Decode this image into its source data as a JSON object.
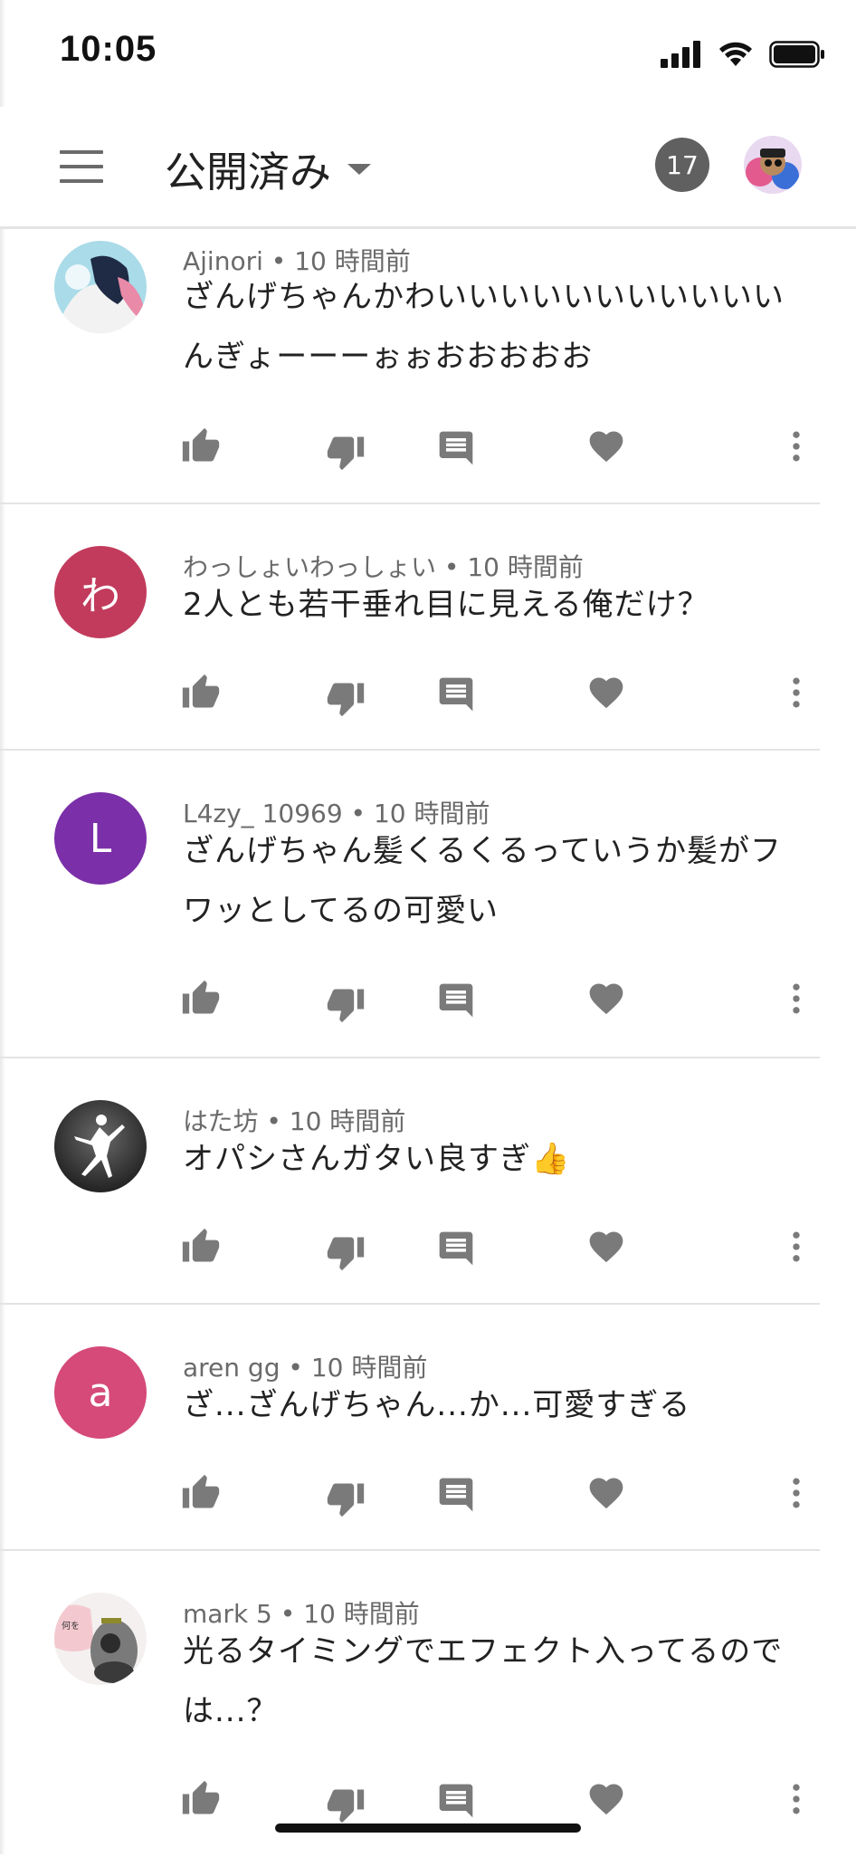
{
  "status_bar": {
    "time": "10:05"
  },
  "app_bar": {
    "title": "公開済み",
    "count_badge": "17"
  },
  "comments": [
    {
      "author": "Ajinori",
      "time": "10 時間前",
      "lines": [
        "ざんげちゃんかわいいいいいいいいいいい",
        "んぎょーーーぉぉおおおおお"
      ],
      "avatar": "image",
      "avatar_color": "#9ccfe0"
    },
    {
      "author": "わっしょいわっしょい",
      "time": "10 時間前",
      "lines": [
        "2人とも若干垂れ目に見える俺だけ？"
      ],
      "avatar": "わ",
      "avatar_color": "#c23b5c"
    },
    {
      "author": "L4zy_ 10969",
      "time": "10 時間前",
      "lines": [
        "ざんげちゃん髪くるくるっていうか髪がフ",
        "ワッとしてるの可愛い"
      ],
      "avatar": "L",
      "avatar_color": "#7b2fa8"
    },
    {
      "author": "はた坊",
      "time": "10 時間前",
      "lines": [
        "オパシさんガタい良すぎ👍"
      ],
      "avatar": "image",
      "avatar_color": "#3a3a3a"
    },
    {
      "author": "aren gg",
      "time": "10 時間前",
      "lines": [
        "ざ...ざんげちゃん...か...可愛すぎる"
      ],
      "avatar": "a",
      "avatar_color": "#d54a78"
    },
    {
      "author": "mark 5",
      "time": "10 時間前",
      "lines": [
        "光るタイミングでエフェクト入ってるので",
        "は...？"
      ],
      "avatar": "image",
      "avatar_color": "#cfc5c5"
    }
  ],
  "icons": {
    "menu": "hamburger-icon",
    "dropdown": "triangle-down-icon",
    "like": "thumb-up-icon",
    "dislike": "thumb-down-icon",
    "reply": "comment-icon",
    "heart": "heart-icon",
    "more": "more-vertical-icon",
    "status": [
      "signal-icon",
      "wifi-icon",
      "battery-icon"
    ]
  },
  "colors": {
    "icon_gray": "#7a7a7a",
    "divider": "#e4e4e4",
    "badge": "#606060"
  }
}
